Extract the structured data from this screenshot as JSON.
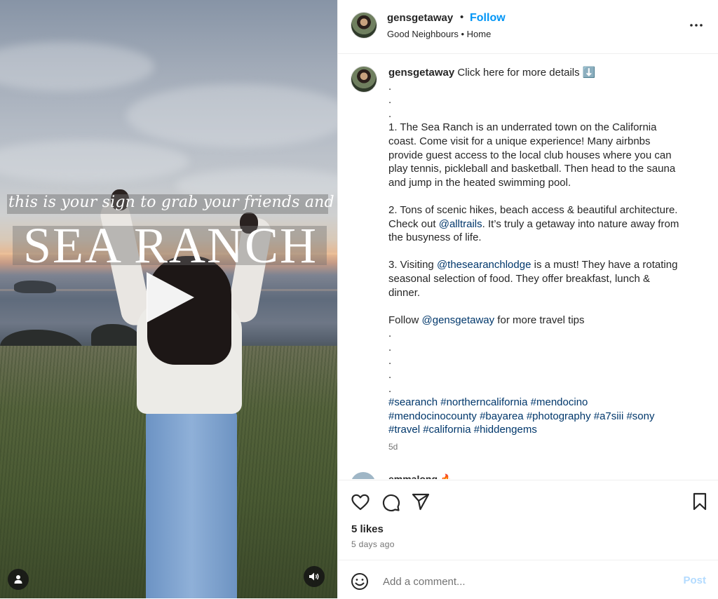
{
  "video": {
    "caption_script": "this is your sign to grab your friends and head to",
    "caption_title": "SEA RANCH",
    "icons": {
      "play": "play-icon",
      "user_tag": "person-icon",
      "audio": "speaker-icon"
    }
  },
  "header": {
    "username": "gensgetaway",
    "separator": "•",
    "follow_label": "Follow",
    "location": "Good Neighbours • Home"
  },
  "caption": {
    "username": "gensgetaway",
    "lines": [
      "Click here for more details ⬇️",
      ".",
      ".",
      ".",
      "1. The Sea Ranch is an underrated town on the California",
      "coast. Come visit for a unique experience! Many airbnbs",
      "provide guest access to the local club houses where you can",
      "play tennis, pickleball and basketball. Then head to the sauna",
      "and jump in the heated swimming pool.",
      "",
      "2. Tons of scenic hikes, beach access & beautiful architecture.",
      "Check out ",
      "@alltrails",
      ". It’s truly a getaway into nature away from",
      "the busyness of life.",
      "",
      "3. Visiting ",
      "@thesearanchlodge",
      " is a must! They have a rotating",
      "seasonal selection of food. They offer breakfast, lunch &",
      "dinner.",
      "",
      "Follow ",
      "@gensgetaway",
      " for more travel tips",
      ".",
      ".",
      ".",
      ".",
      "."
    ],
    "hashtags": [
      "#searanch",
      "#northerncalifornia",
      "#mendocino",
      "#mendocinocounty",
      "#bayarea",
      "#photography",
      "#a7siii",
      "#sony",
      "#travel",
      "#california",
      "#hiddengems"
    ],
    "time": "5d"
  },
  "next_comment": {
    "username": "emmalong 🔥"
  },
  "actions": {
    "likes": "5 likes",
    "ago": "5 days ago",
    "icons": {
      "like": "heart-icon",
      "comment": "comment-icon",
      "share": "send-icon",
      "save": "bookmark-icon"
    }
  },
  "add_comment": {
    "placeholder": "Add a comment...",
    "post_label": "Post"
  },
  "colors": {
    "link": "#0095f6",
    "mention": "#00376b",
    "muted": "#737373",
    "post_disabled": "#b3dbff"
  }
}
